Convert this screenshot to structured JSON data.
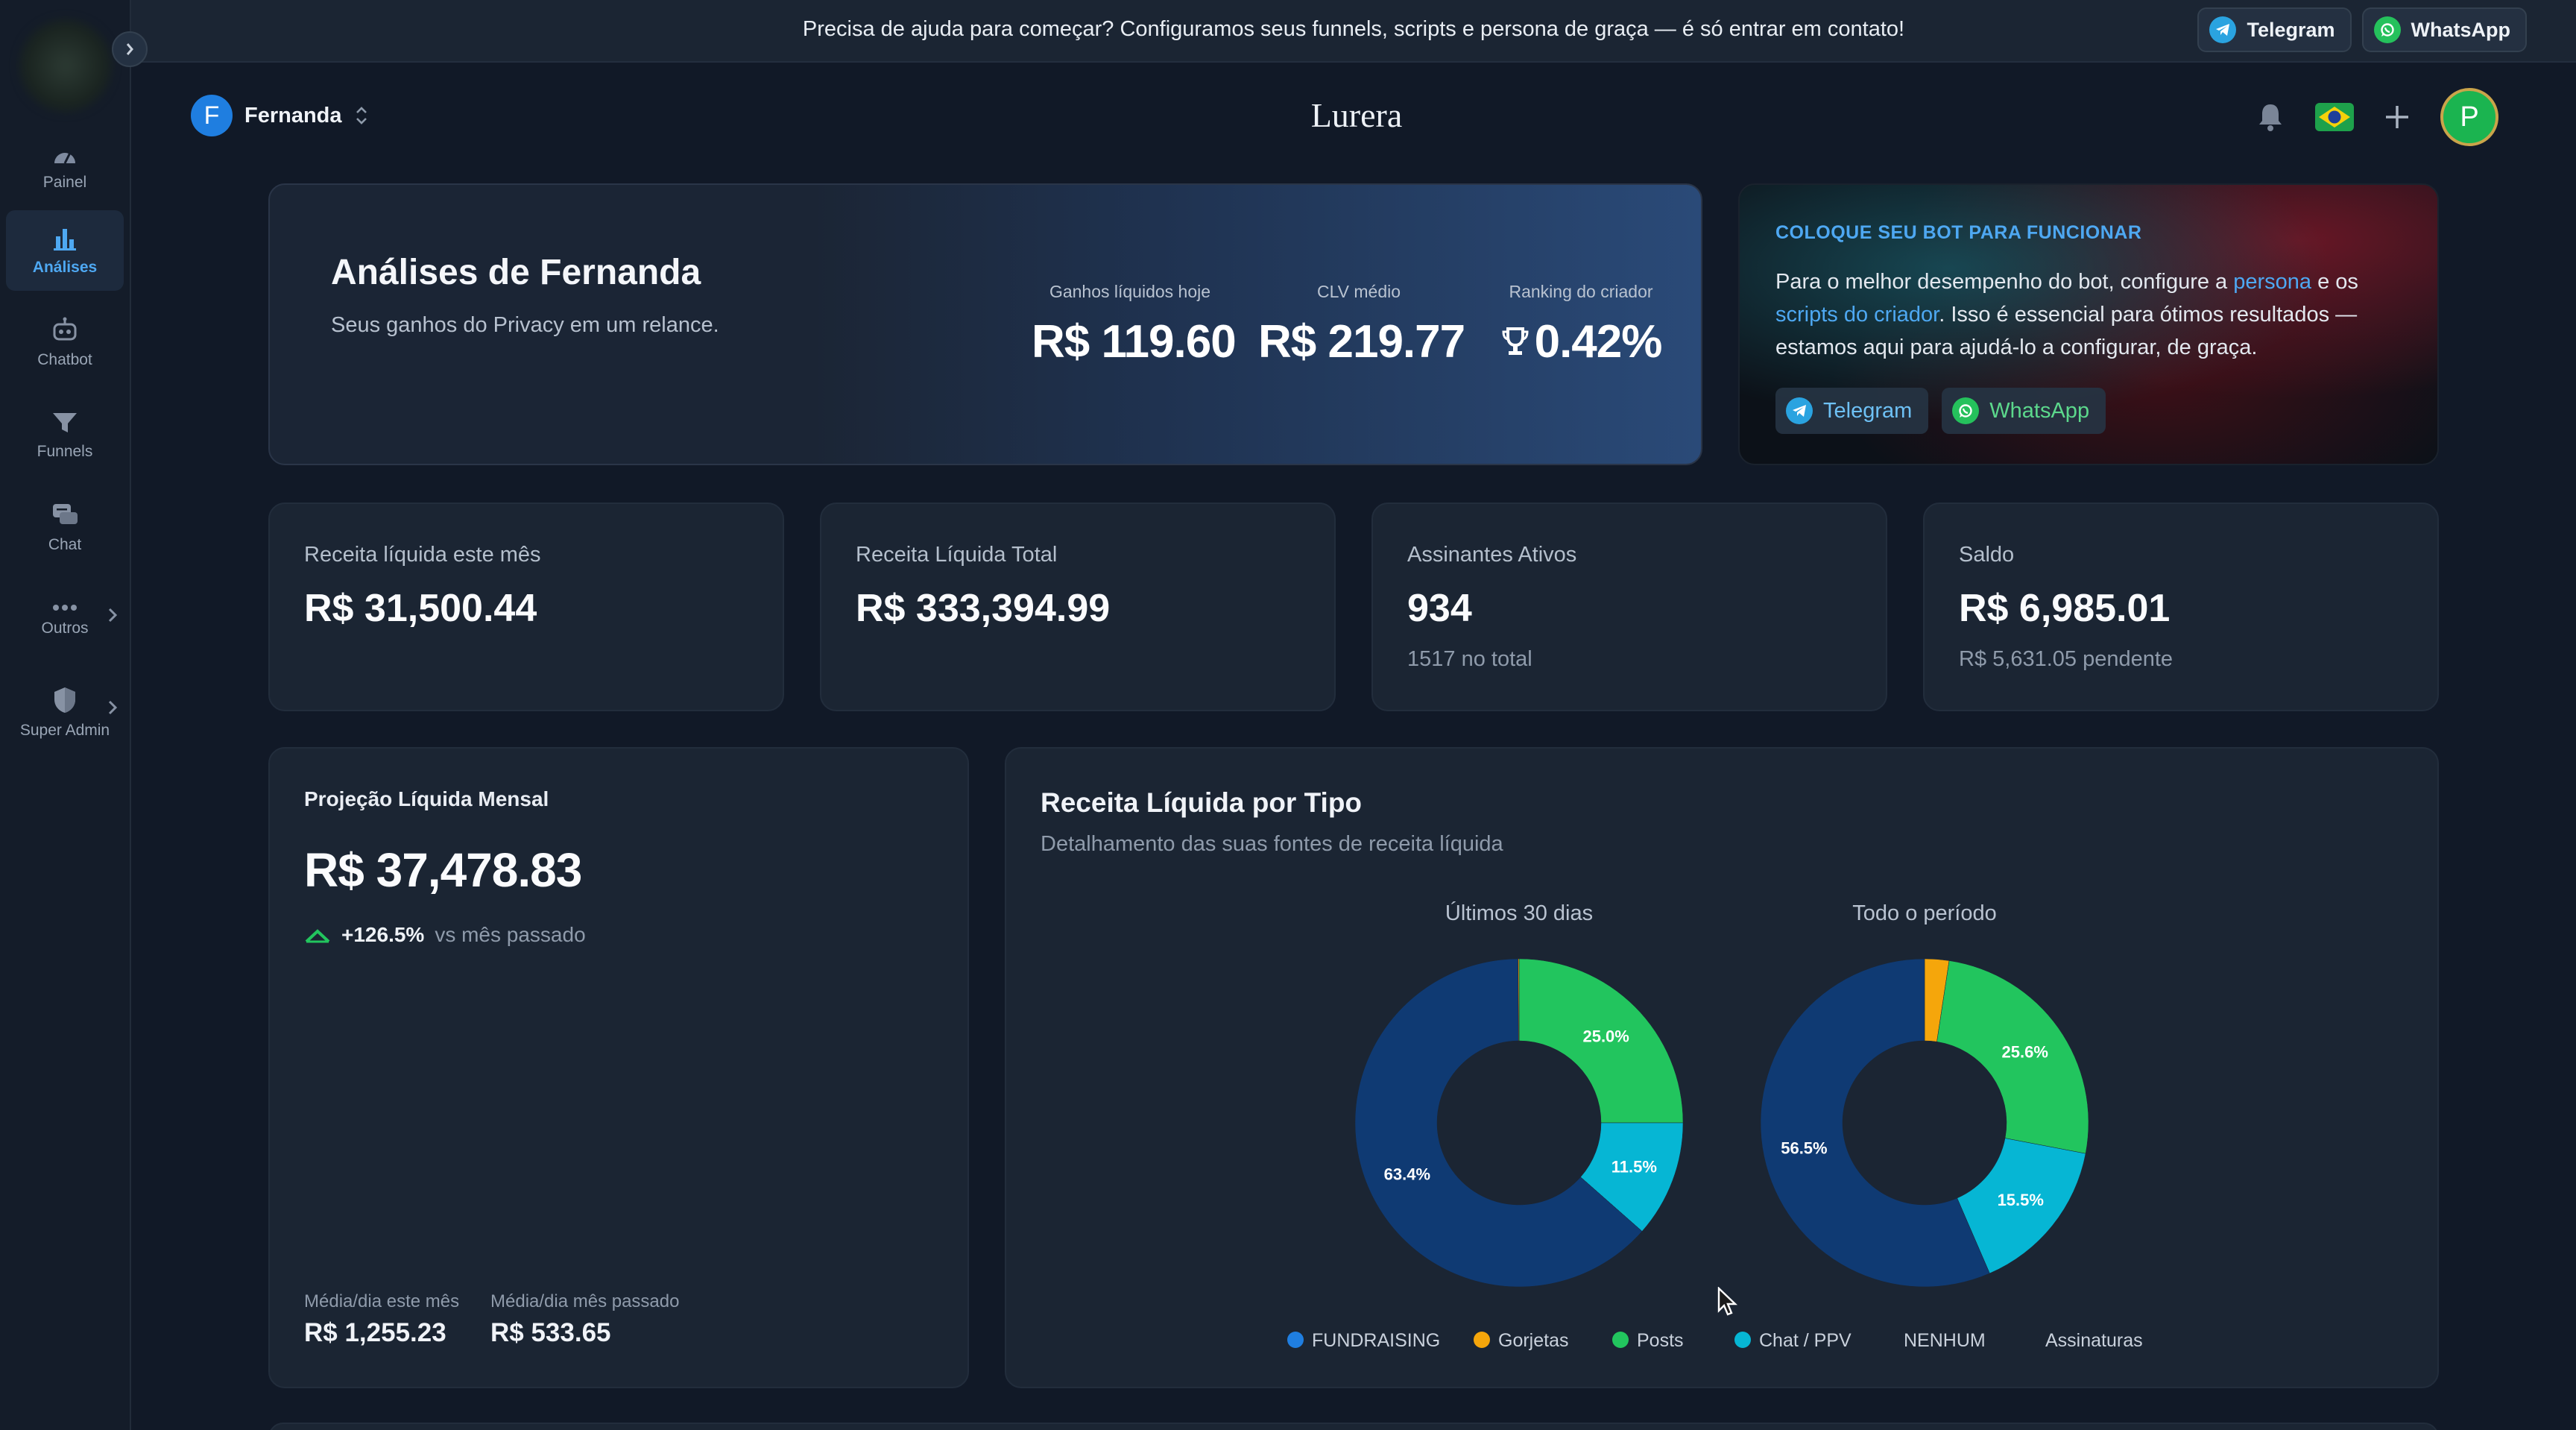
{
  "banner": {
    "text": "Precisa de ajuda para começar? Configuramos seus funnels, scripts e persona de graça — é só entrar em contato!",
    "telegram_label": "Telegram",
    "whatsapp_label": "WhatsApp"
  },
  "sidebar": {
    "items": [
      {
        "label": "Painel",
        "icon": "gauge-icon"
      },
      {
        "label": "Análises",
        "icon": "bar-chart-icon",
        "active": true
      },
      {
        "label": "Chatbot",
        "icon": "robot-icon"
      },
      {
        "label": "Funnels",
        "icon": "funnel-icon"
      },
      {
        "label": "Chat",
        "icon": "chat-icon"
      },
      {
        "label": "Outros",
        "icon": "more-icon"
      },
      {
        "label": "Super Admin",
        "icon": "shield-icon"
      }
    ]
  },
  "header": {
    "account_initial": "F",
    "account_name": "Fernanda",
    "brand": "Lurera",
    "profile_initial": "P"
  },
  "hero": {
    "title": "Análises de Fernanda",
    "subtitle": "Seus ganhos do Privacy em um relance.",
    "stats": [
      {
        "label": "Ganhos líquidos hoje",
        "value": "R$ 119.60"
      },
      {
        "label": "CLV médio",
        "value": "R$ 219.77"
      },
      {
        "label": "Ranking do criador",
        "value": "0.42%"
      }
    ]
  },
  "bot_card": {
    "heading": "COLOQUE SEU BOT PARA FUNCIONAR",
    "body_1": "Para o melhor desempenho do bot, configure a ",
    "link_1": "persona",
    "body_2": " e os ",
    "link_2": "scripts do criador",
    "body_3": ". Isso é essencial para ótimos resultados — estamos aqui para ajudá-lo a configurar, de graça.",
    "telegram_label": "Telegram",
    "whatsapp_label": "WhatsApp"
  },
  "stats": [
    {
      "label": "Receita líquida este mês",
      "value": "R$ 31,500.44",
      "sub": ""
    },
    {
      "label": "Receita Líquida Total",
      "value": "R$ 333,394.99",
      "sub": ""
    },
    {
      "label": "Assinantes Ativos",
      "value": "934",
      "sub": "1517 no total"
    },
    {
      "label": "Saldo",
      "value": "R$ 6,985.01",
      "sub": "R$ 5,631.05 pendente"
    }
  ],
  "projection": {
    "label": "Projeção Líquida Mensal",
    "value": "R$ 37,478.83",
    "trend_pct": "+126.5%",
    "trend_cmp": "vs mês passado",
    "avg_this_label": "Média/dia este mês",
    "avg_this_value": "R$ 1,255.23",
    "avg_last_label": "Média/dia mês passado",
    "avg_last_value": "R$ 533.65"
  },
  "chart_data": {
    "type": "pie",
    "title": "Receita Líquida por Tipo",
    "subtitle": "Detalhamento das suas fontes de receita líquida",
    "legend": [
      {
        "name": "FUNDRAISING",
        "color": "#1f7ee0"
      },
      {
        "name": "Gorjetas",
        "color": "#f5a60b"
      },
      {
        "name": "Posts",
        "color": "#22c55e"
      },
      {
        "name": "Chat / PPV",
        "color": "#06b6d4"
      },
      {
        "name": "NENHUM",
        "color": ""
      },
      {
        "name": "Assinaturas",
        "color": ""
      }
    ],
    "pies": [
      {
        "title": "Últimos 30 dias",
        "slices": [
          {
            "name": "Posts",
            "value": 25.0,
            "color": "#22c55e",
            "label": "25.0%"
          },
          {
            "name": "Chat / PPV",
            "value": 11.5,
            "color": "#06b6d4",
            "label": "11.5%"
          },
          {
            "name": "FUNDRAISING",
            "value": 63.4,
            "color": "#0f3a73",
            "label": "63.4%"
          },
          {
            "name": "Gorjetas",
            "value": 0.1,
            "color": "#f5a60b",
            "label": ""
          }
        ]
      },
      {
        "title": "Todo o período",
        "slices": [
          {
            "name": "Gorjetas",
            "value": 2.4,
            "color": "#f5a60b",
            "label": ""
          },
          {
            "name": "Posts",
            "value": 25.6,
            "color": "#22c55e",
            "label": "25.6%"
          },
          {
            "name": "Chat / PPV",
            "value": 15.5,
            "color": "#06b6d4",
            "label": "15.5%"
          },
          {
            "name": "FUNDRAISING",
            "value": 56.5,
            "color": "#0f3a73",
            "label": "56.5%"
          }
        ]
      }
    ]
  }
}
